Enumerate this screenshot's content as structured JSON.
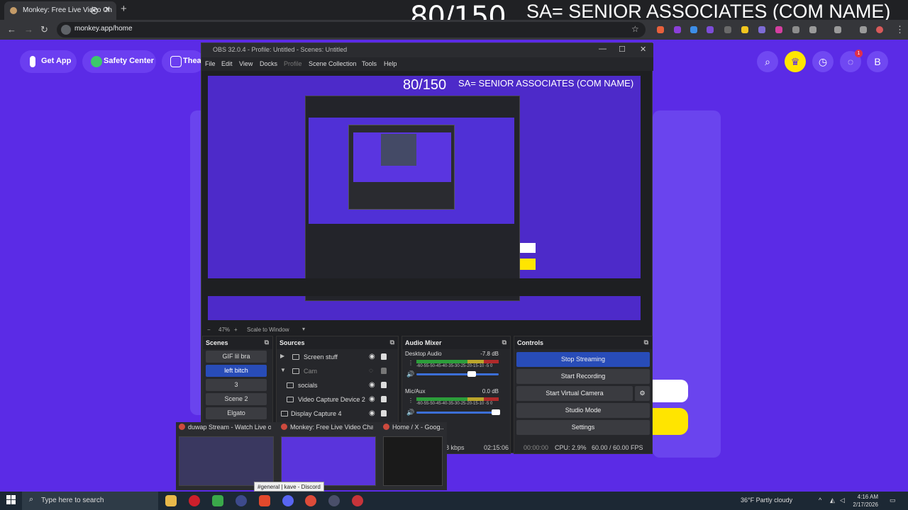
{
  "browser": {
    "tab_title": "Monkey: Free Live Video Ch",
    "tab_close": "✕",
    "new_tab": "+",
    "url": "monkey.app/home",
    "nav": {
      "back": "←",
      "forward": "→",
      "reload": "↻"
    },
    "star": "☆"
  },
  "overlay": {
    "count": "80/150",
    "title": "SA= SENIOR ASSOCIATES (COM NAME)"
  },
  "page": {
    "get_app": "Get App",
    "safety_center": "Safety Center",
    "theater": "Thea",
    "notification_badge": "1",
    "profile_initial": "B",
    "icons": [
      "search-icon",
      "crown-icon",
      "clock-icon",
      "chat-icon",
      "profile-icon"
    ],
    "accent": "#5b2be6",
    "yellow": "#ffe500"
  },
  "obs": {
    "title": "OBS 32.0.4 - Profile: Untitled - Scenes: Untitled",
    "menu": [
      "File",
      "Edit",
      "View",
      "Docks",
      "Profile",
      "Scene Collection",
      "Tools",
      "Help"
    ],
    "preview": {
      "zoom": "47%",
      "scale": "Scale to Window",
      "count": "80/150",
      "title": "SA= SENIOR ASSOCIATES (COM NAME)"
    },
    "scenes": {
      "header": "Scenes",
      "items": [
        "GIF lil bra",
        "left bitch",
        "3",
        "Scene 2",
        "Elgato"
      ],
      "selected": "left bitch"
    },
    "sources": {
      "header": "Sources",
      "items": [
        "Screen stuff",
        "Cam",
        "socials",
        "Video Capture Device 2",
        "Display Capture 4"
      ]
    },
    "mixer": {
      "header": "Audio Mixer",
      "channels": [
        {
          "name": "Desktop Audio",
          "db": "-7.8 dB"
        },
        {
          "name": "Mic/Aux",
          "db": "0.0 dB"
        }
      ],
      "scale": "-60-55-50-45-40-35-30-25-20-15-10 -5  0"
    },
    "controls": {
      "header": "Controls",
      "buttons": [
        "Stop Streaming",
        "Start Recording",
        "Start Virtual Camera",
        "Studio Mode",
        "Settings"
      ]
    },
    "status": {
      "bitrate": "8 kbps",
      "stream_time": "02:15:06",
      "rec_time": "00:00:00",
      "cpu": "CPU: 2.9%",
      "fps": "60.00 / 60.00 FPS"
    }
  },
  "thumbnails": [
    {
      "title": "duwap Stream - Watch Live on ..."
    },
    {
      "title": "Monkey: Free Live Video Chat t..."
    },
    {
      "title": "Home / X - Goog..."
    }
  ],
  "tooltip": "#general | kave - Discord",
  "taskbar": {
    "search_placeholder": "Type here to search",
    "weather": "36°F  Partly cloudy",
    "time": "4:16 AM",
    "date": "2/17/2026"
  }
}
